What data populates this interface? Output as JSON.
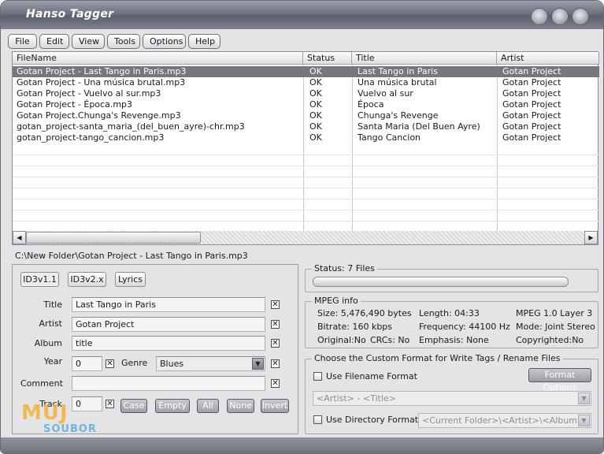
{
  "app": {
    "title": "Hanso Tagger"
  },
  "menu": [
    "File",
    "Edit",
    "View",
    "Tools",
    "Options",
    "Help"
  ],
  "filelist": {
    "columns": [
      "FileName",
      "Status",
      "Title",
      "Artist"
    ],
    "rows": [
      {
        "file": "Gotan Project - Last Tango in Paris.mp3",
        "status": "OK",
        "title": "Last Tango in Paris",
        "artist": "Gotan Project"
      },
      {
        "file": "Gotan Project - Una música brutal.mp3",
        "status": "OK",
        "title": "Una música brutal",
        "artist": "Gotan Project"
      },
      {
        "file": "Gotan Project - Vuelvo al sur.mp3",
        "status": "OK",
        "title": "Vuelvo al sur",
        "artist": "Gotan Project"
      },
      {
        "file": "Gotan Project - Época.mp3",
        "status": "OK",
        "title": "Época",
        "artist": "Gotan Project"
      },
      {
        "file": "Gotan Project.Chunga's Revenge.mp3",
        "status": "OK",
        "title": "Chunga's Revenge",
        "artist": "Gotan Project"
      },
      {
        "file": "gotan_project-santa_maria_(del_buen_ayre)-chr.mp3",
        "status": "OK",
        "title": "Santa Maria (Del Buen Ayre)",
        "artist": "Gotan Project"
      },
      {
        "file": "gotan_project-tango_cancion.mp3",
        "status": "OK",
        "title": "Tango Cancion",
        "artist": "Gotan Project"
      }
    ]
  },
  "path": "C:\\New Folder\\Gotan Project - Last Tango in Paris.mp3",
  "tabs": [
    "ID3v1.1",
    "ID3v2.x",
    "Lyrics"
  ],
  "tags": {
    "title_label": "Title",
    "title_value": "Last Tango in Paris",
    "artist_label": "Artist",
    "artist_value": "Gotan Project",
    "album_label": "Album",
    "album_value": "title",
    "year_label": "Year",
    "year_value": "0",
    "genre_label": "Genre",
    "genre_value": "Blues",
    "comment_label": "Comment",
    "comment_value": "",
    "track_label": "Track",
    "track_value": "0"
  },
  "buttons": {
    "case": "Case",
    "empty": "Empty",
    "all": "All",
    "none": "None",
    "invert": "Invert"
  },
  "status": {
    "label": "Status: 7 Files"
  },
  "mpeg": {
    "heading": "MPEG info",
    "size": "Size: 5,476,490 bytes",
    "length": "Length: 04:33",
    "layer": "MPEG 1.0 Layer 3",
    "bitrate": "Bitrate: 160 kbps",
    "frequency": "Frequency: 44100 Hz",
    "mode": "Mode: Joint Stereo",
    "original": "Original:No",
    "crcs": "CRCs: No",
    "emphasis": "Emphasis: None",
    "copyrighted": "Copyrighted:No"
  },
  "format": {
    "heading": "Choose the Custom Format for Write Tags / Rename Files",
    "use_filename": "Use Filename Format",
    "format_options": "Format Options",
    "filename_pattern": "<Artist> - <Title>",
    "use_directory": "Use Directory Format",
    "directory_pattern": "<Current Folder>\\<Artist>\\<Album>\\"
  },
  "watermark": {
    "top": "MUJ",
    "bottom": "SOUBOR"
  },
  "colors": {
    "selection": "#75777e",
    "titlebar": "#6c717d"
  }
}
